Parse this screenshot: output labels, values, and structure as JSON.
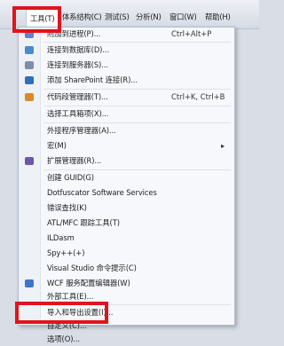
{
  "menubar": {
    "items": [
      "工具(T)",
      "体系结构(C)",
      "测试(S)",
      "分析(N)",
      "窗口(W)",
      "帮助(H)"
    ]
  },
  "menu": {
    "items": [
      {
        "label": "附加到进程(P)...",
        "shortcut": "Ctrl+Alt+P",
        "icon": "attach-process-icon",
        "color": "#5b86c9"
      },
      {
        "label": "连接到数据库(D)...",
        "icon": "database-icon",
        "color": "#4a8cc7"
      },
      {
        "label": "连接到服务器(S)...",
        "icon": "server-icon",
        "color": "#7d8fa8"
      },
      {
        "label": "添加 SharePoint 连接(R)...",
        "icon": "sharepoint-icon",
        "color": "#2e6fb7"
      },
      {
        "label": "代码段管理器(T)...",
        "shortcut": "Ctrl+K, Ctrl+B",
        "icon": "snippet-icon",
        "color": "#d98b2b"
      },
      {
        "label": "选择工具箱项(X)..."
      },
      {
        "label": "外接程序管理器(A)..."
      },
      {
        "label": "宏(M)",
        "submenu": "▸"
      },
      {
        "label": "扩展管理器(R)...",
        "icon": "extension-icon",
        "color": "#6a58a8"
      },
      {
        "label": "创建 GUID(G)"
      },
      {
        "label": "Dotfuscator Software Services"
      },
      {
        "label": "错误查找(K)"
      },
      {
        "label": "ATL/MFC 跟踪工具(T)"
      },
      {
        "label": "ILDasm"
      },
      {
        "label": "Spy++(+)"
      },
      {
        "label": "Visual Studio 命令提示(C)"
      },
      {
        "label": "WCF 服务配置编辑器(W)",
        "icon": "wcf-icon",
        "color": "#3a78c4"
      },
      {
        "label": "外部工具(E)..."
      },
      {
        "label": "导入和导出设置(I)..."
      },
      {
        "label": "自定义(C)..."
      },
      {
        "label": "选项(O)..."
      }
    ]
  }
}
